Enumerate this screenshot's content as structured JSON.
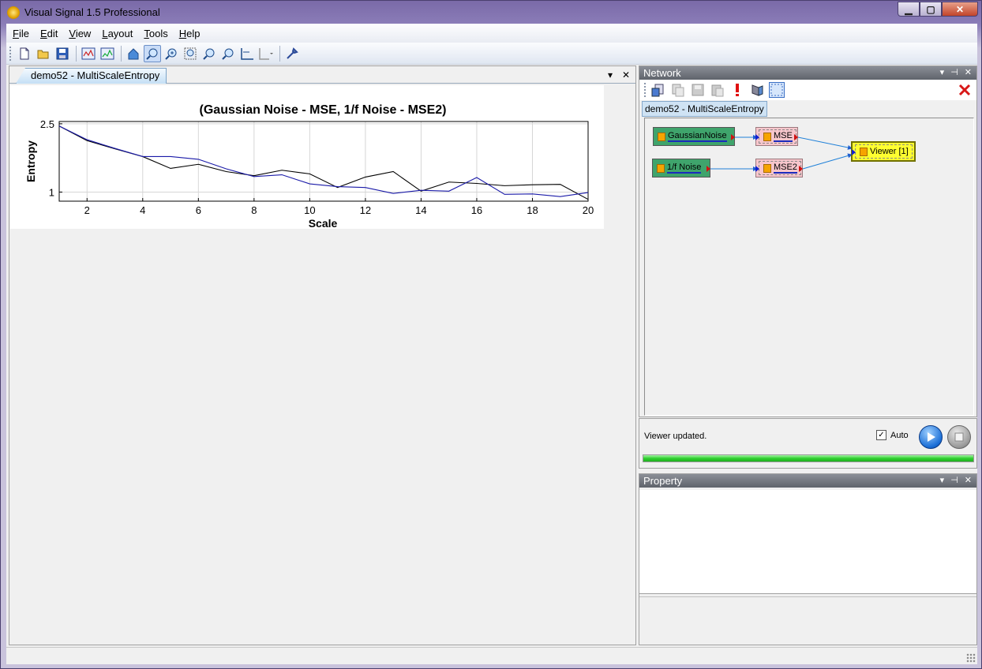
{
  "window": {
    "title": "Visual Signal 1.5 Professional"
  },
  "menu": [
    {
      "label": "File",
      "key": "F",
      "rest": "ile"
    },
    {
      "label": "Edit",
      "key": "E",
      "rest": "dit"
    },
    {
      "label": "View",
      "key": "V",
      "rest": "iew"
    },
    {
      "label": "Layout",
      "key": "L",
      "rest": "ayout"
    },
    {
      "label": "Tools",
      "key": "T",
      "rest": "ools"
    },
    {
      "label": "Help",
      "key": "H",
      "rest": "elp"
    }
  ],
  "toolbar": {
    "icons": [
      "new-file-icon",
      "open-folder-icon",
      "save-icon",
      "viewer-icon",
      "viewer-alt-icon",
      "home-icon",
      "zoom-pan-icon",
      "zoom-in-icon",
      "zoom-rect-icon",
      "zoom-x-icon",
      "zoom-y-icon",
      "axis-scale-icon",
      "axis-scale-dropdown-icon",
      "tools-icon"
    ],
    "pressed": "zoom-pan-icon"
  },
  "document": {
    "tab_label": "demo52 - MultiScaleEntropy"
  },
  "chart_data": {
    "type": "line",
    "title": "(Gaussian Noise - MSE, 1/f Noise - MSE2)",
    "xlabel": "Scale",
    "ylabel": "Entropy",
    "xlim": [
      1,
      20
    ],
    "ylim": [
      0.8,
      2.55
    ],
    "xticks": [
      2,
      4,
      6,
      8,
      10,
      12,
      14,
      16,
      18,
      20
    ],
    "yticks": [
      1,
      2.5
    ],
    "grid": true,
    "x": [
      1,
      2,
      3,
      4,
      5,
      6,
      7,
      8,
      9,
      10,
      11,
      12,
      13,
      14,
      15,
      16,
      17,
      18,
      19,
      20
    ],
    "series": [
      {
        "color": "#000000",
        "values": [
          2.45,
          2.13,
          1.95,
          1.78,
          1.52,
          1.61,
          1.45,
          1.36,
          1.48,
          1.4,
          1.1,
          1.33,
          1.45,
          1.02,
          1.22,
          1.19,
          1.14,
          1.16,
          1.17,
          0.84
        ]
      },
      {
        "color": "#1a1aa8",
        "values": [
          2.45,
          2.15,
          1.96,
          1.78,
          1.78,
          1.72,
          1.51,
          1.34,
          1.38,
          1.18,
          1.12,
          1.1,
          0.97,
          1.04,
          1.02,
          1.32,
          0.95,
          0.96,
          0.9,
          0.99
        ]
      }
    ]
  },
  "network": {
    "header": "Network",
    "tab_label": "demo52 - MultiScaleEntropy",
    "tools": [
      "add-module-icon",
      "copy-icon",
      "save-network-icon",
      "paste-icon",
      "error-icon",
      "refresh-icon",
      "select-icon"
    ],
    "nodes": [
      {
        "id": "gaussian",
        "label": "GaussianNoise",
        "kind": "src"
      },
      {
        "id": "mse",
        "label": "MSE",
        "kind": "proc"
      },
      {
        "id": "fnoise",
        "label": "1/f Noise",
        "kind": "src"
      },
      {
        "id": "mse2",
        "label": "MSE2",
        "kind": "proc"
      },
      {
        "id": "viewer",
        "label": "Viewer [1]",
        "kind": "view"
      }
    ]
  },
  "status": {
    "text": "Viewer updated.",
    "auto_label": "Auto",
    "auto_checked": true,
    "progress": 1.0
  },
  "property": {
    "header": "Property"
  },
  "colors": {
    "accent": "#1a6ed6",
    "chart_blue": "#1a1aa8",
    "node_green": "#3fa46c",
    "node_pink": "#f7c6cc",
    "node_yellow": "#ffff30"
  }
}
